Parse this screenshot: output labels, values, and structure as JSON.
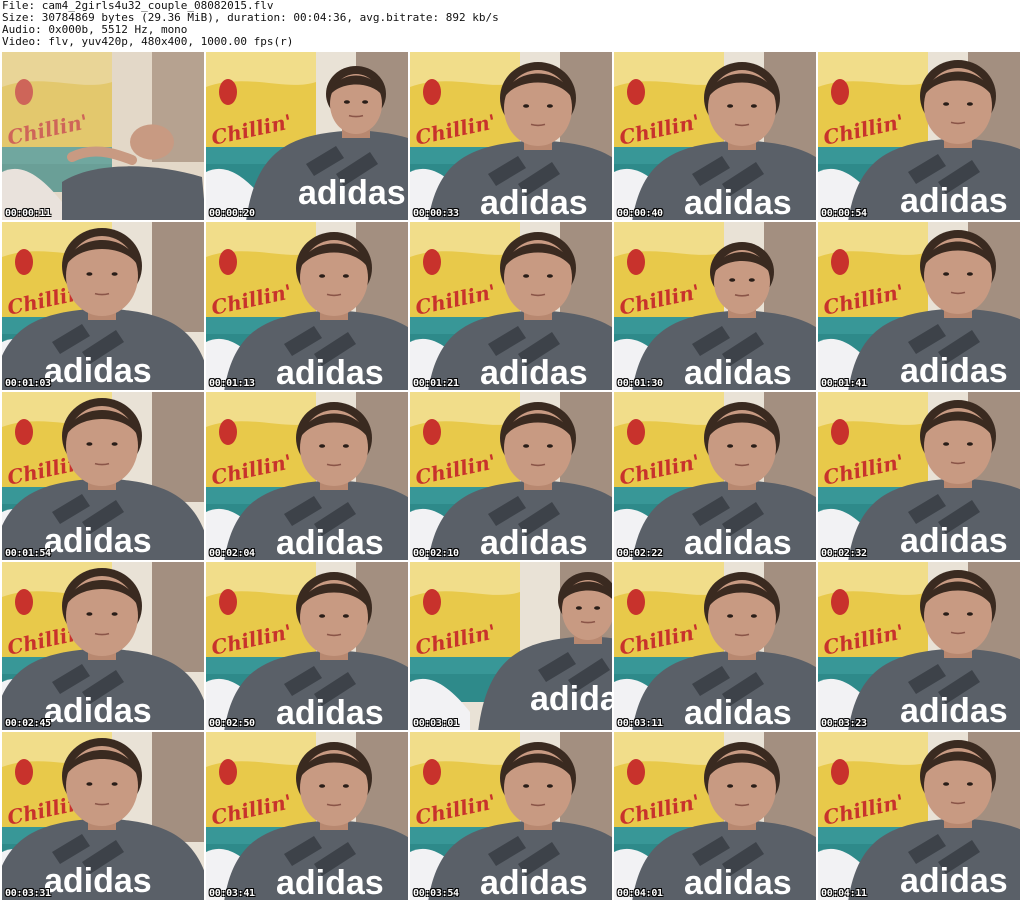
{
  "header": {
    "file": "File: cam4_2girls4u32_couple_08082015.flv",
    "size": "Size: 30784869 bytes (29.36 MiB), duration: 00:04:36, avg.bitrate: 892 kb/s",
    "audio": "Audio: 0x000b, 5512 Hz, mono",
    "video": "Video: flv, yuv420p, 480x400, 1000.00 fps(r)"
  },
  "thumbnails": [
    {
      "time": "00:00:11",
      "scene": "lying"
    },
    {
      "time": "00:00:20",
      "scene": "far"
    },
    {
      "time": "00:00:33",
      "scene": "close"
    },
    {
      "time": "00:00:40",
      "scene": "close"
    },
    {
      "time": "00:00:54",
      "scene": "close-right"
    },
    {
      "time": "00:01:03",
      "scene": "close-left"
    },
    {
      "time": "00:01:13",
      "scene": "close"
    },
    {
      "time": "00:01:21",
      "scene": "close"
    },
    {
      "time": "00:01:30",
      "scene": "mid"
    },
    {
      "time": "00:01:41",
      "scene": "close-right"
    },
    {
      "time": "00:01:54",
      "scene": "close-left"
    },
    {
      "time": "00:02:04",
      "scene": "close"
    },
    {
      "time": "00:02:10",
      "scene": "close"
    },
    {
      "time": "00:02:22",
      "scene": "close"
    },
    {
      "time": "00:02:32",
      "scene": "close-right"
    },
    {
      "time": "00:02:45",
      "scene": "close-left"
    },
    {
      "time": "00:02:50",
      "scene": "close"
    },
    {
      "time": "00:03:01",
      "scene": "far-right"
    },
    {
      "time": "00:03:11",
      "scene": "close"
    },
    {
      "time": "00:03:23",
      "scene": "close-right"
    },
    {
      "time": "00:03:31",
      "scene": "close-left"
    },
    {
      "time": "00:03:41",
      "scene": "close"
    },
    {
      "time": "00:03:54",
      "scene": "close"
    },
    {
      "time": "00:04:01",
      "scene": "close"
    },
    {
      "time": "00:04:11",
      "scene": "close-right"
    }
  ],
  "shirt_text": "adidas",
  "banner_text": "Chillin'",
  "colors": {
    "background": "#ffffff",
    "shirt": "#5a6068",
    "skin": "#c89a82",
    "hair": "#3a2a20",
    "banner_yellow": "#e8c94a",
    "banner_red": "#c8322c",
    "banner_teal": "#2e8a8a",
    "wall": "#e9e2d6"
  }
}
